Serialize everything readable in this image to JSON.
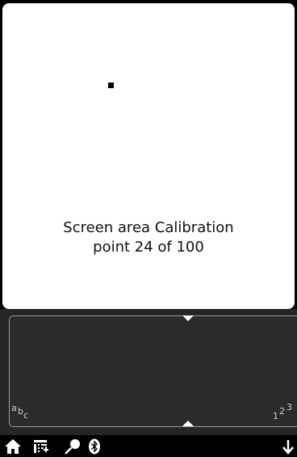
{
  "calibration": {
    "line1": "Screen area Calibration",
    "line2": "point 24 of 100",
    "current_point": 24,
    "total_points": 100
  },
  "input_panel": {
    "mode_left": [
      "a",
      "b",
      "c"
    ],
    "mode_right": [
      "1",
      "2",
      "3"
    ]
  },
  "toolbar": {
    "icons": [
      "home-icon",
      "menu-icon",
      "search-icon",
      "bluetooth-icon",
      "arrow-down-icon"
    ]
  },
  "colors": {
    "screen_bg": "#ffffff",
    "panel_bg": "#262626",
    "frame_bg": "#000000",
    "text": "#111111"
  }
}
